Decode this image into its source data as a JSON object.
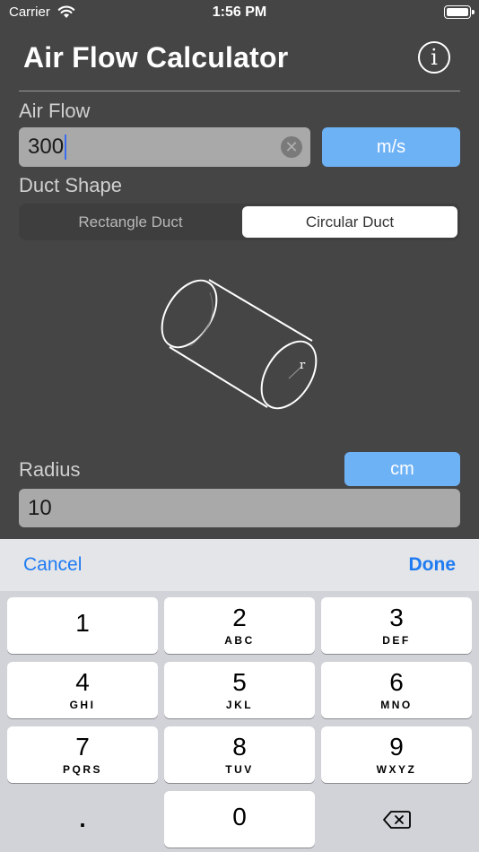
{
  "status": {
    "carrier": "Carrier",
    "time": "1:56 PM"
  },
  "header": {
    "title": "Air Flow Calculator",
    "info_glyph": "i"
  },
  "air_flow": {
    "label": "Air Flow",
    "value": "300",
    "unit": "m/s"
  },
  "duct_shape": {
    "label": "Duct Shape",
    "options": [
      "Rectangle Duct",
      "Circular Duct"
    ],
    "selected": "Circular Duct"
  },
  "illustration": {
    "radius_label": "r"
  },
  "radius": {
    "label": "Radius",
    "value": "10",
    "unit": "cm"
  },
  "keyboard": {
    "cancel": "Cancel",
    "done": "Done",
    "keys": [
      {
        "num": "1",
        "letters": ""
      },
      {
        "num": "2",
        "letters": "ABC"
      },
      {
        "num": "3",
        "letters": "DEF"
      },
      {
        "num": "4",
        "letters": "GHI"
      },
      {
        "num": "5",
        "letters": "JKL"
      },
      {
        "num": "6",
        "letters": "MNO"
      },
      {
        "num": "7",
        "letters": "PQRS"
      },
      {
        "num": "8",
        "letters": "TUV"
      },
      {
        "num": "9",
        "letters": "WXYZ"
      },
      {
        "num": "0",
        "letters": ""
      }
    ],
    "decimal": "."
  },
  "colors": {
    "accent": "#6eb2f6",
    "link": "#1f7bf2",
    "background": "#454545"
  }
}
